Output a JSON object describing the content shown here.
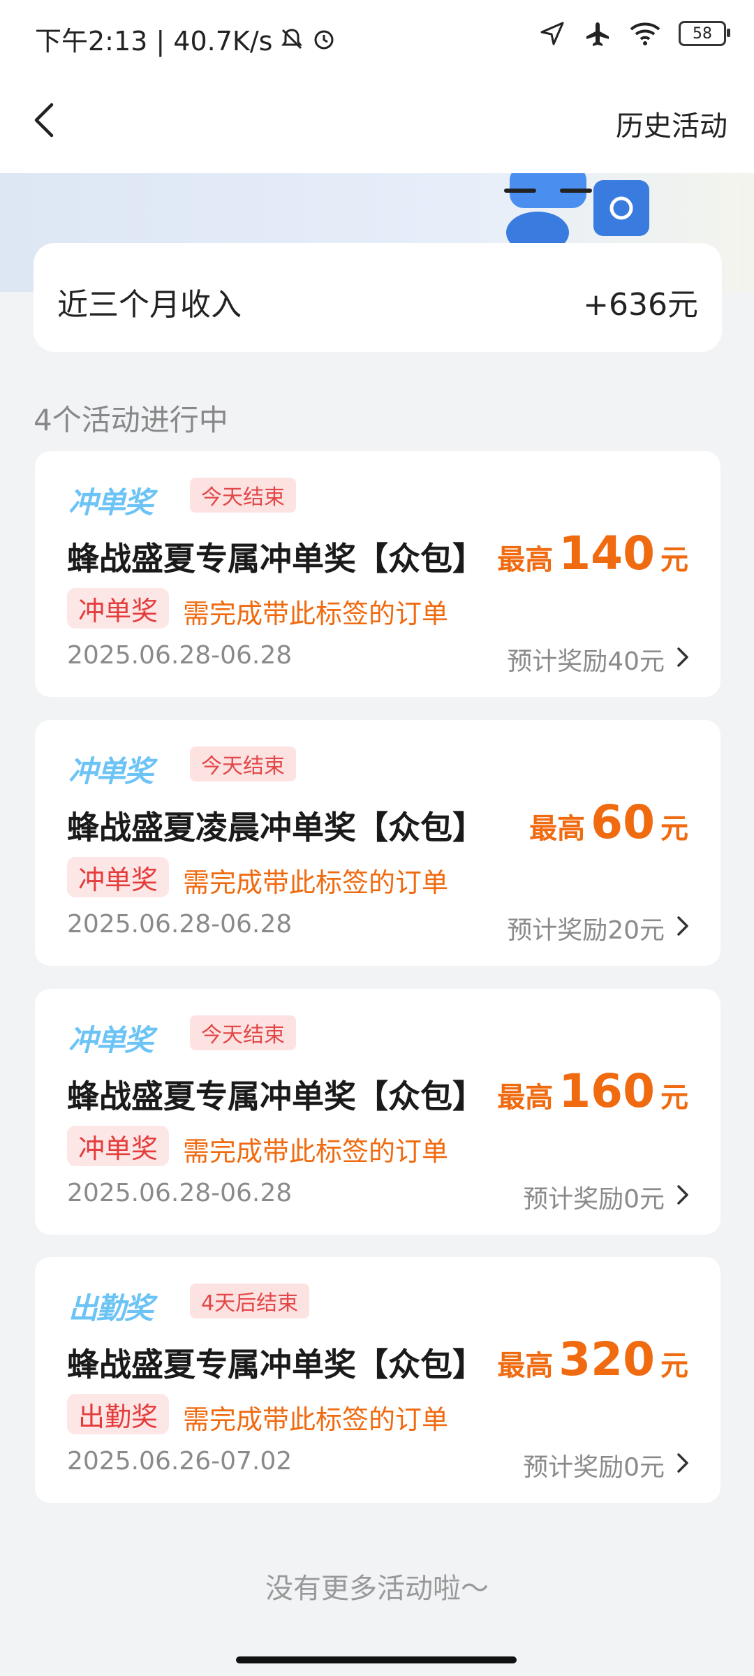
{
  "status_bar": {
    "time_speed": "下午2:13 | 40.7K/s",
    "battery": "58"
  },
  "nav": {
    "history_label": "历史活动"
  },
  "income": {
    "label": "近三个月收入",
    "value": "+636元"
  },
  "section_title": "4个活动进行中",
  "activities": [
    {
      "type_logo": "冲单奖",
      "end_badge": "今天结束",
      "title": "蜂战盛夏专属冲单奖【众包】",
      "max_label": "最高",
      "max_amount": "140",
      "max_unit": "元",
      "tag": "冲单奖",
      "tag_desc": "需完成带此标签的订单",
      "date_range": "2025.06.28-06.28",
      "estimate": "预计奖励40元"
    },
    {
      "type_logo": "冲单奖",
      "end_badge": "今天结束",
      "title": "蜂战盛夏凌晨冲单奖【众包】",
      "max_label": "最高",
      "max_amount": "60",
      "max_unit": "元",
      "tag": "冲单奖",
      "tag_desc": "需完成带此标签的订单",
      "date_range": "2025.06.28-06.28",
      "estimate": "预计奖励20元"
    },
    {
      "type_logo": "冲单奖",
      "end_badge": "今天结束",
      "title": "蜂战盛夏专属冲单奖【众包】",
      "max_label": "最高",
      "max_amount": "160",
      "max_unit": "元",
      "tag": "冲单奖",
      "tag_desc": "需完成带此标签的订单",
      "date_range": "2025.06.28-06.28",
      "estimate": "预计奖励0元"
    },
    {
      "type_logo": "出勤奖",
      "end_badge": "4天后结束",
      "title": "蜂战盛夏专属冲单奖【众包】",
      "max_label": "最高",
      "max_amount": "320",
      "max_unit": "元",
      "tag": "出勤奖",
      "tag_desc": "需完成带此标签的订单",
      "date_range": "2025.06.26-07.02",
      "estimate": "预计奖励0元"
    }
  ],
  "footer_text": "没有更多活动啦～",
  "colors": {
    "accent_orange": "#f06a10",
    "tag_red": "#e43b3b",
    "logo_blue": "#6cc3f5"
  }
}
